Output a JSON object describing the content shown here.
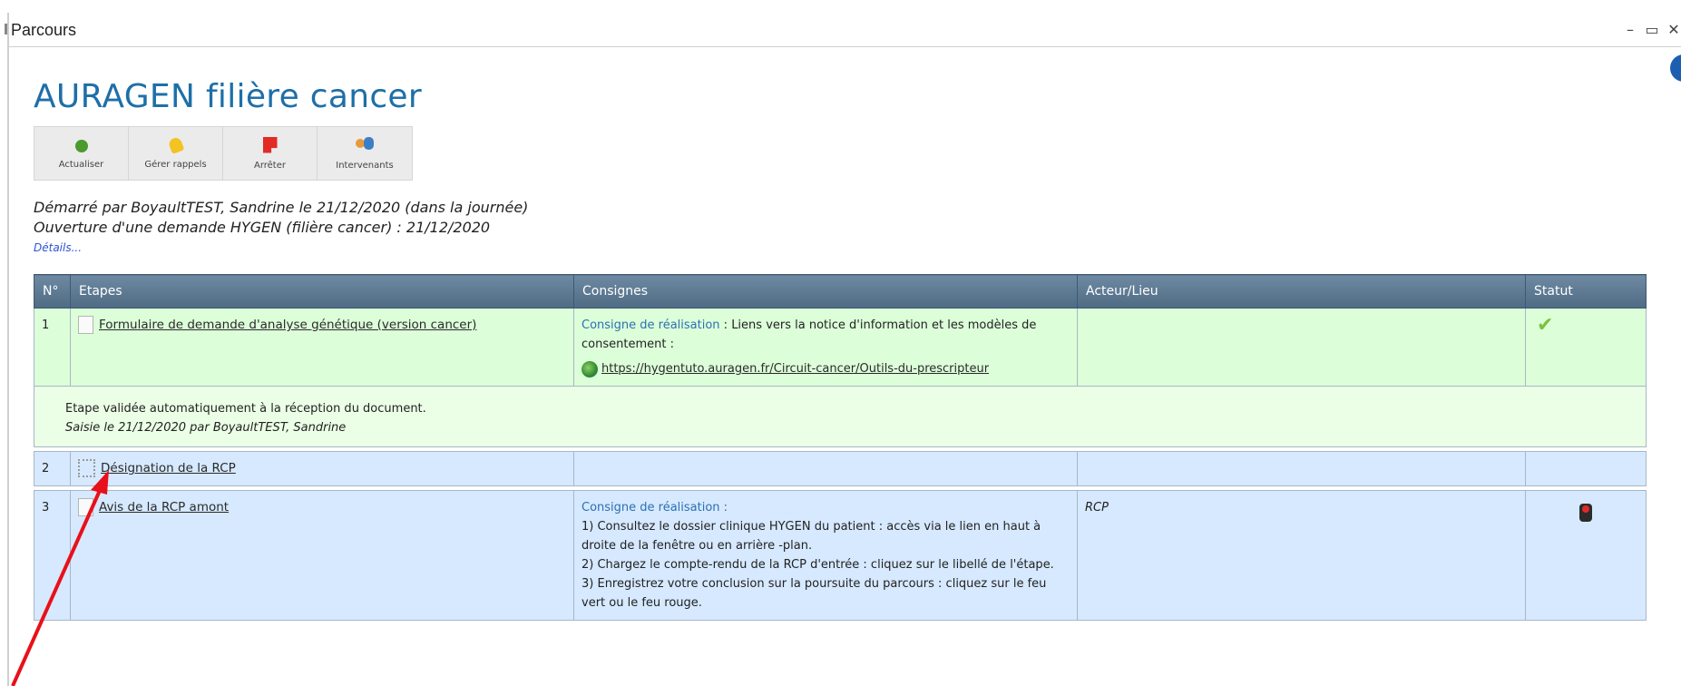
{
  "window": {
    "title": "Parcours",
    "controls": {
      "minimize": "–",
      "maximize": "▭",
      "close": "✕"
    }
  },
  "page": {
    "title": "AURAGEN filière cancer",
    "info_icon": "i"
  },
  "toolbar": {
    "buttons": [
      {
        "label": "Actualiser",
        "icon": "refresh-icon"
      },
      {
        "label": "Gérer rappels",
        "icon": "bell-icon"
      },
      {
        "label": "Arrêter",
        "icon": "stop-icon"
      },
      {
        "label": "Intervenants",
        "icon": "people-icon"
      }
    ]
  },
  "meta": {
    "started": "Démarré par BoyaultTEST, Sandrine le 21/12/2020 (dans la journée)",
    "opening": "Ouverture d'une demande HYGEN (filière cancer) : 21/12/2020",
    "details_link": "Détails..."
  },
  "table": {
    "headers": [
      "N°",
      "Etapes",
      "Consignes",
      "Acteur/Lieu",
      "Statut"
    ],
    "rows": [
      {
        "num": "1",
        "step": "Formulaire de demande d'analyse génétique (version cancer)",
        "consigne_title": "Consigne de réalisation",
        "consigne_text": " : Liens vers la notice d'information et les modèles de consentement :",
        "url": "https://hygentuto.auragen.fr/Circuit-cancer/Outils-du-prescripteur",
        "actor": "",
        "status": "✔",
        "note_line1": "Etape validée automatiquement à la réception du document.",
        "note_line2": "Saisie le 21/12/2020 par BoyaultTEST, Sandrine"
      },
      {
        "num": "2",
        "step": "Désignation de la RCP",
        "actor": ""
      },
      {
        "num": "3",
        "step": "Avis de la RCP amont",
        "consigne_title": "Consigne de réalisation :",
        "consigne_lines": [
          "1) Consultez le dossier clinique HYGEN du patient : accès via le lien en haut à droite de la fenêtre ou en arrière -plan.",
          "2) Chargez le compte-rendu de la RCP d'entrée : cliquez sur le libellé de l'étape.",
          "3) Enregistrez votre conclusion sur la poursuite du parcours : cliquez sur le feu vert ou le feu rouge."
        ],
        "actor": "RCP",
        "status_icon": "traffic-light-icon"
      }
    ]
  },
  "colors": {
    "title_blue": "#1e6fa8",
    "header_bg": "#5a7690",
    "row_green": "#dcffd9",
    "row_blue": "#d6e9ff",
    "arrow_red": "#e8101a"
  }
}
